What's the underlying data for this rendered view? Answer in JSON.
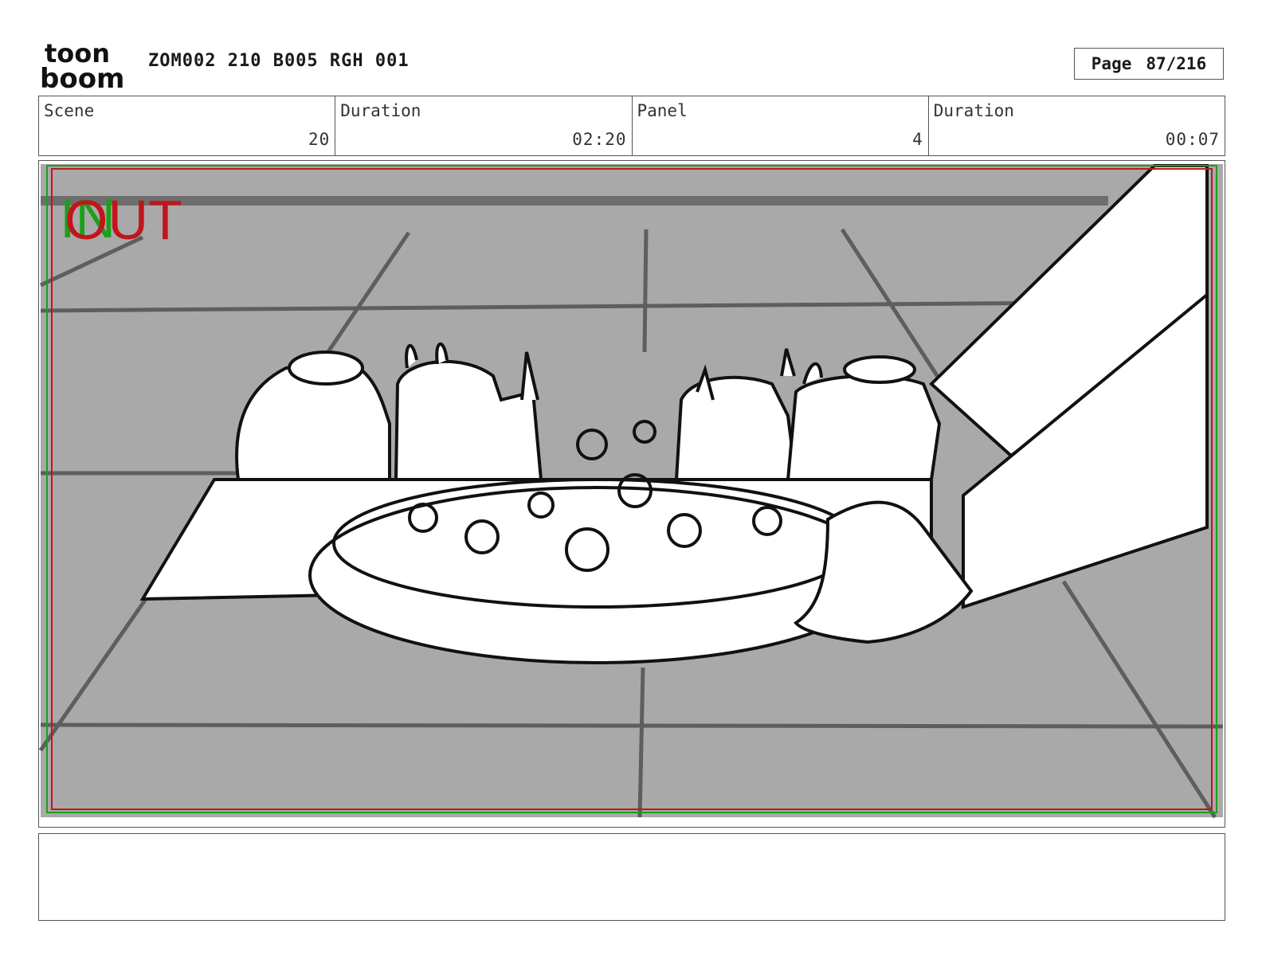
{
  "header": {
    "logo_text_top": "toon",
    "logo_text_bottom": "boom",
    "project": "ZOM002 210 B005 RGH 001",
    "page_label": "Page",
    "page_value": "87/216"
  },
  "info": {
    "scene_label": "Scene",
    "scene_value": "20",
    "scene_duration_label": "Duration",
    "scene_duration_value": "02:20",
    "panel_label": "Panel",
    "panel_value": "4",
    "panel_duration_label": "Duration",
    "panel_duration_value": "00:07"
  },
  "panel": {
    "in_marker": "IN",
    "out_marker": "OUT",
    "colors": {
      "in_marker": "#1aa01a",
      "out_marker": "#c0161b",
      "floor": "#a9a9a9",
      "safe_frame_red": "#c0161b",
      "safe_frame_green": "#1aa01a"
    }
  },
  "notes": {
    "text": ""
  }
}
